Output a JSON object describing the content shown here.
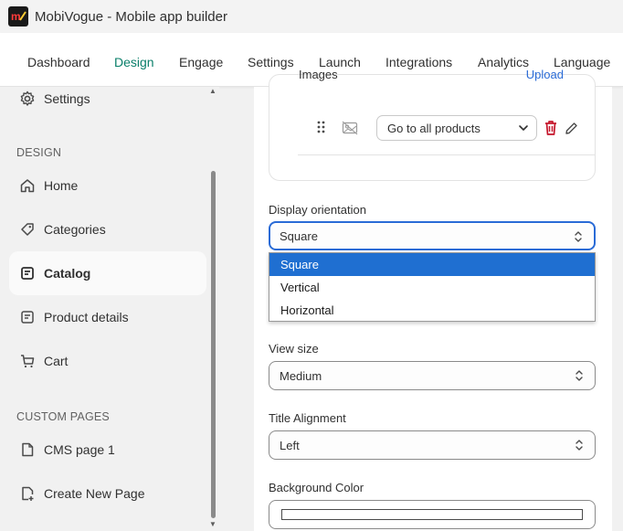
{
  "window": {
    "title": "MobiVogue - Mobile app builder",
    "logo_text": "m"
  },
  "topnav": {
    "tabs": [
      {
        "label": "Dashboard"
      },
      {
        "label": "Design"
      },
      {
        "label": "Engage"
      },
      {
        "label": "Settings"
      },
      {
        "label": "Launch"
      },
      {
        "label": "Integrations"
      },
      {
        "label": "Analytics"
      },
      {
        "label": "Language"
      }
    ],
    "active": "Design",
    "active_color": "#0a7f6a"
  },
  "sidebar": {
    "top_item": {
      "label": "Settings",
      "icon": "gear-icon"
    },
    "design_section": "DESIGN",
    "design_items": [
      {
        "label": "Home",
        "icon": "home-icon"
      },
      {
        "label": "Categories",
        "icon": "tag-icon"
      },
      {
        "label": "Catalog",
        "icon": "catalog-icon",
        "active": true
      },
      {
        "label": "Product details",
        "icon": "product-details-icon"
      },
      {
        "label": "Cart",
        "icon": "cart-icon"
      }
    ],
    "custom_section": "CUSTOM PAGES",
    "custom_items": [
      {
        "label": "CMS page 1",
        "icon": "page-icon"
      },
      {
        "label": "Create New Page",
        "icon": "new-page-icon"
      }
    ]
  },
  "main": {
    "images_card": {
      "label": "Images",
      "upload_link": "Upload",
      "link_select_value": "Go to all products"
    },
    "display_orientation": {
      "label": "Display orientation",
      "value": "Square",
      "options": [
        "Square",
        "Vertical",
        "Horizontal"
      ],
      "selected_index": 0
    },
    "view_size": {
      "label": "View size",
      "value": "Medium"
    },
    "title_alignment": {
      "label": "Title Alignment",
      "value": "Left"
    },
    "background_color": {
      "label": "Background Color",
      "value": "#ffffff"
    }
  },
  "colors": {
    "accent_blue": "#2a6bd6",
    "delete_red": "#c5162b",
    "selected_option": "#1f6fd1"
  }
}
